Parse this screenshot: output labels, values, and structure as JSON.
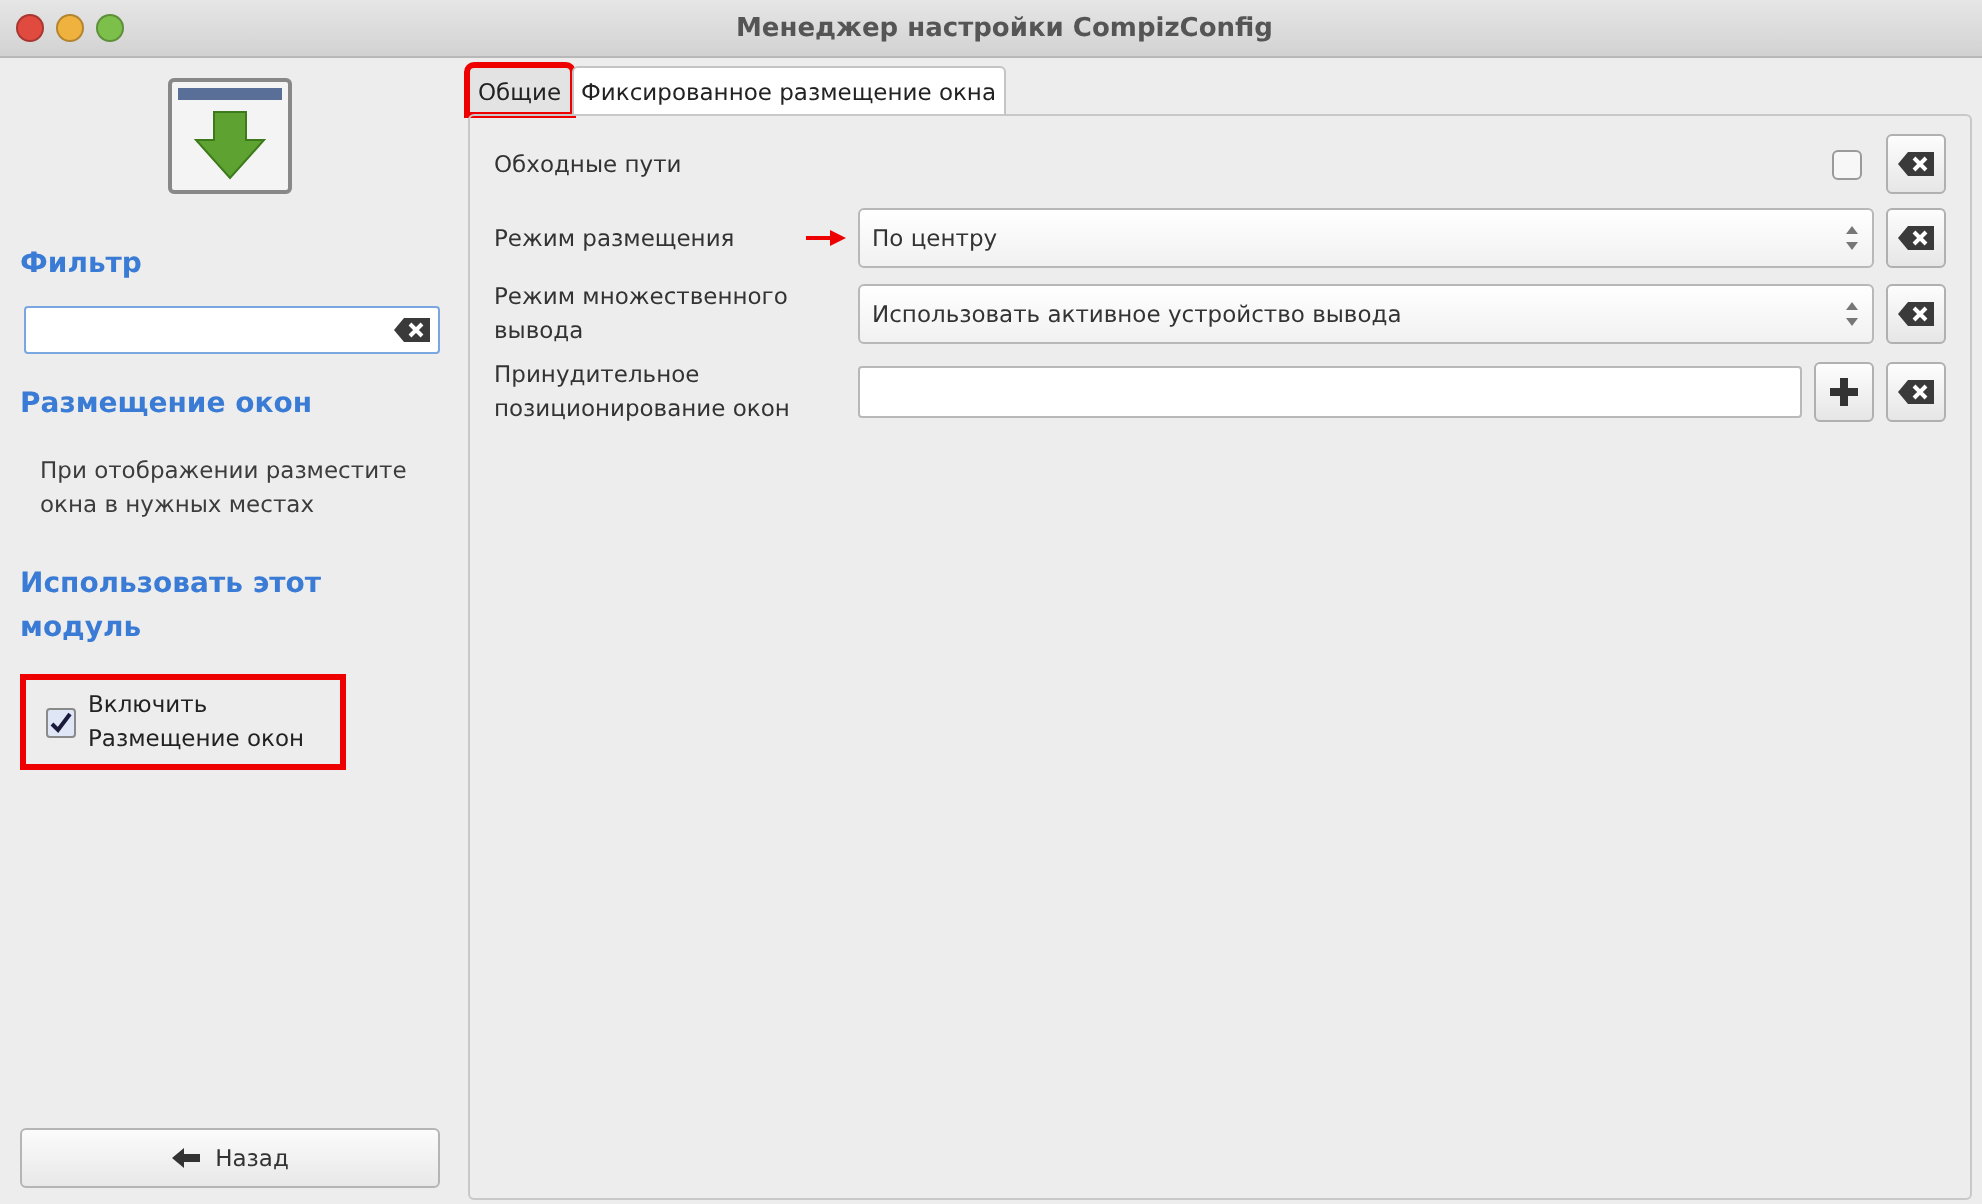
{
  "window": {
    "title": "Менеджер настройки CompizConfig"
  },
  "sidebar": {
    "filter_label": "Фильтр",
    "plugin_name": "Размещение окон",
    "description": "При отображении разместите окна в нужных местах",
    "use_heading": "Использовать этот модуль",
    "enable": {
      "label": "Включить Размещение окон",
      "checked": true,
      "annotated": true
    },
    "back_button": "Назад"
  },
  "tabs": [
    {
      "label": "Общие",
      "selected": true,
      "annotated": true
    },
    {
      "label": "Фиксированное размещение окна",
      "selected": false,
      "annotated": false
    }
  ],
  "settings": [
    {
      "kind": "checkbox",
      "label": "Обходные пути",
      "checked": false,
      "annotated": false
    },
    {
      "kind": "select",
      "label": "Режим размещения",
      "value": "По центру",
      "annotated": true
    },
    {
      "kind": "select",
      "label": "Режим множественного вывода",
      "value": "Использовать активное устройство вывода",
      "annotated": false
    },
    {
      "kind": "list",
      "label": "Принудительное позиционирование окон",
      "annotated": false
    }
  ]
}
